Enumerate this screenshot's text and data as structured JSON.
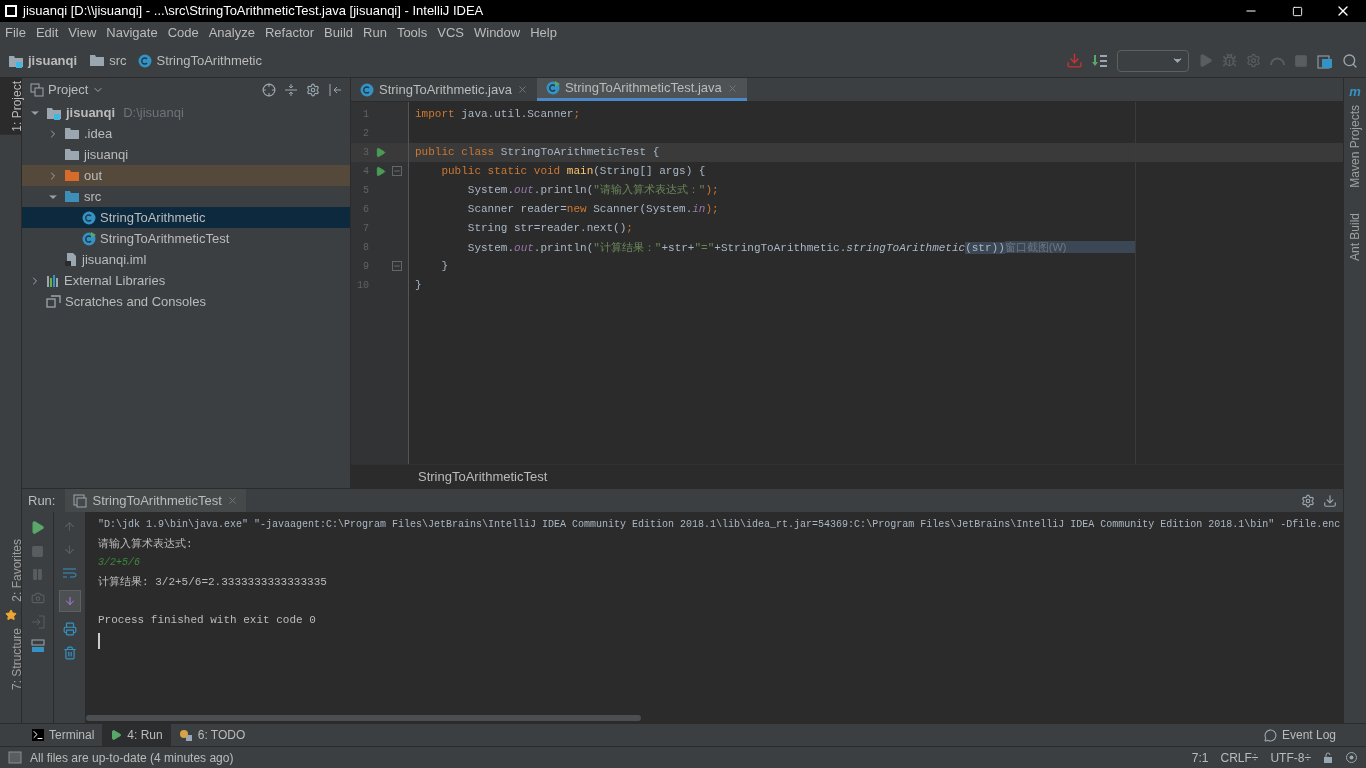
{
  "window": {
    "title": "jisuanqi [D:\\\\jisuanqi] - ...\\src\\StringToArithmeticTest.java [jisuanqi] - IntelliJ IDEA"
  },
  "menu": [
    "File",
    "Edit",
    "View",
    "Navigate",
    "Code",
    "Analyze",
    "Refactor",
    "Build",
    "Run",
    "Tools",
    "VCS",
    "Window",
    "Help"
  ],
  "breadcrumb": [
    {
      "label": "jisuanqi",
      "kind": "module"
    },
    {
      "label": "src",
      "kind": "folder"
    },
    {
      "label": "StringToArithmetic",
      "kind": "class"
    }
  ],
  "left_strip": [
    {
      "label": "1: Project",
      "selected": true
    },
    {
      "label": "2: Favorites",
      "selected": false
    },
    {
      "label": "7: Structure",
      "selected": false
    }
  ],
  "right_strip": {
    "logo": "m",
    "tabs": [
      "Maven Projects",
      "Ant Build"
    ]
  },
  "project": {
    "title": "Project",
    "tree": [
      {
        "label": "jisuanqi",
        "path": "D:\\jisuanqi",
        "kind": "module",
        "expandable": true,
        "expanded": true,
        "selected": false,
        "children": [
          {
            "label": ".idea",
            "kind": "folder",
            "expandable": true,
            "expanded": false,
            "selected": false
          },
          {
            "label": "jisuanqi",
            "kind": "folder",
            "expandable": false,
            "selected": false
          },
          {
            "label": "out",
            "kind": "folder-excluded",
            "expandable": true,
            "expanded": false,
            "selected": false,
            "highlighted": true
          },
          {
            "label": "src",
            "kind": "folder-source",
            "expandable": true,
            "expanded": true,
            "selected": false,
            "children": [
              {
                "label": "StringToArithmetic",
                "kind": "class",
                "expandable": false,
                "selected": true
              },
              {
                "label": "StringToArithmeticTest",
                "kind": "class-test",
                "expandable": false,
                "selected": false
              }
            ]
          },
          {
            "label": "jisuanqi.iml",
            "kind": "iml",
            "expandable": false,
            "selected": false
          }
        ]
      },
      {
        "label": "External Libraries",
        "kind": "libraries",
        "expandable": true,
        "expanded": false,
        "selected": false
      },
      {
        "label": "Scratches and Consoles",
        "kind": "scratches",
        "expandable": false,
        "selected": false
      }
    ]
  },
  "editor": {
    "tabs": [
      {
        "label": "StringToArithmetic.java",
        "kind": "class",
        "selected": false
      },
      {
        "label": "StringToArithmeticTest.java",
        "kind": "class-test",
        "selected": true
      }
    ],
    "lines": [
      {
        "number": "1",
        "current": false,
        "run_marker": false,
        "fold": false,
        "tokens": [
          {
            "text": "import ",
            "kind": "keyword"
          },
          {
            "text": "java.util.Scanner",
            "kind": "plain"
          },
          {
            "text": ";",
            "kind": "keyword"
          }
        ]
      },
      {
        "number": "2",
        "current": false,
        "run_marker": false,
        "fold": false
      },
      {
        "number": "3",
        "current": true,
        "run_marker": true,
        "fold": false,
        "tokens": [
          {
            "text": "public class ",
            "kind": "keyword"
          },
          {
            "text": "StringToArithmeticTest {",
            "kind": "plain"
          }
        ]
      },
      {
        "number": "4",
        "current": false,
        "run_marker": true,
        "fold": true,
        "tokens": [
          {
            "text": "    public static void ",
            "kind": "keyword"
          },
          {
            "text": "main",
            "kind": "method"
          },
          {
            "text": "(String[] args) {",
            "kind": "plain"
          }
        ]
      },
      {
        "number": "5",
        "current": false,
        "run_marker": false,
        "fold": false,
        "tokens": [
          {
            "text": "        System.",
            "kind": "plain"
          },
          {
            "text": "out",
            "kind": "field"
          },
          {
            "text": ".println(",
            "kind": "plain"
          },
          {
            "text": "\"请输入算术表达式：\"",
            "kind": "string"
          },
          {
            "text": ");",
            "kind": "keyword"
          }
        ]
      },
      {
        "number": "6",
        "current": false,
        "run_marker": false,
        "fold": false,
        "tokens": [
          {
            "text": "        Scanner reader=",
            "kind": "plain"
          },
          {
            "text": "new ",
            "kind": "keyword"
          },
          {
            "text": "Scanner(System.",
            "kind": "plain"
          },
          {
            "text": "in",
            "kind": "field"
          },
          {
            "text": ");",
            "kind": "keyword"
          }
        ]
      },
      {
        "number": "7",
        "current": false,
        "run_marker": false,
        "fold": false,
        "tokens": [
          {
            "text": "        String str=reader.next()",
            "kind": "plain"
          },
          {
            "text": ";",
            "kind": "keyword"
          }
        ]
      },
      {
        "number": "8",
        "current": false,
        "run_marker": false,
        "fold": false,
        "tokens": [
          {
            "text": "        System.",
            "kind": "plain"
          },
          {
            "text": "out",
            "kind": "field"
          },
          {
            "text": ".println(",
            "kind": "plain"
          },
          {
            "text": "\"计算结果：\"",
            "kind": "string"
          },
          {
            "text": "+str+",
            "kind": "plain"
          },
          {
            "text": "\"=\"",
            "kind": "string"
          },
          {
            "text": "+StringToArithmetic.",
            "kind": "plain"
          },
          {
            "text": "stringToArithmetic",
            "kind": "static"
          },
          {
            "text": "(str))",
            "kind": "selection"
          },
          {
            "text": "窗口截图(W)",
            "kind": "hint"
          }
        ]
      },
      {
        "number": "9",
        "current": false,
        "run_marker": false,
        "fold": true,
        "tokens": [
          {
            "text": "    }",
            "kind": "plain"
          }
        ]
      },
      {
        "number": "10",
        "current": false,
        "run_marker": false,
        "fold": false,
        "tokens": [
          {
            "text": "}",
            "kind": "plain"
          }
        ]
      }
    ],
    "footer": "StringToArithmeticTest"
  },
  "run": {
    "label": "Run:",
    "tab": "StringToArithmeticTest",
    "console": [
      {
        "kind": "cmd",
        "text": "\"D:\\jdk 1.9\\bin\\java.exe\" \"-javaagent:C:\\Program Files\\JetBrains\\IntelliJ IDEA Community Edition 2018.1\\lib\\idea_rt.jar=54369:C:\\Program Files\\JetBrains\\IntelliJ IDEA Community Edition 2018.1\\bin\" -Dfile.enc"
      },
      {
        "kind": "output",
        "text": "请输入算术表达式:"
      },
      {
        "kind": "input",
        "text": "3/2+5/6"
      },
      {
        "kind": "output",
        "text": "计算结果: 3/2+5/6=2.3333333333333335"
      },
      {
        "kind": "blank"
      },
      {
        "kind": "output",
        "text": "Process finished with exit code 0"
      },
      {
        "kind": "cursor"
      }
    ]
  },
  "tool_tabs": [
    {
      "label": "Terminal",
      "kind": "terminal",
      "selected": false
    },
    {
      "label": "4: Run",
      "kind": "run",
      "selected": true
    },
    {
      "label": "6: TODO",
      "kind": "todo",
      "selected": false
    }
  ],
  "event_log": "Event Log",
  "status_bar": {
    "message": "All files are up-to-date (4 minutes ago)",
    "position": "7:1",
    "line_sep": "CRLF÷",
    "encoding": "UTF-8÷"
  }
}
